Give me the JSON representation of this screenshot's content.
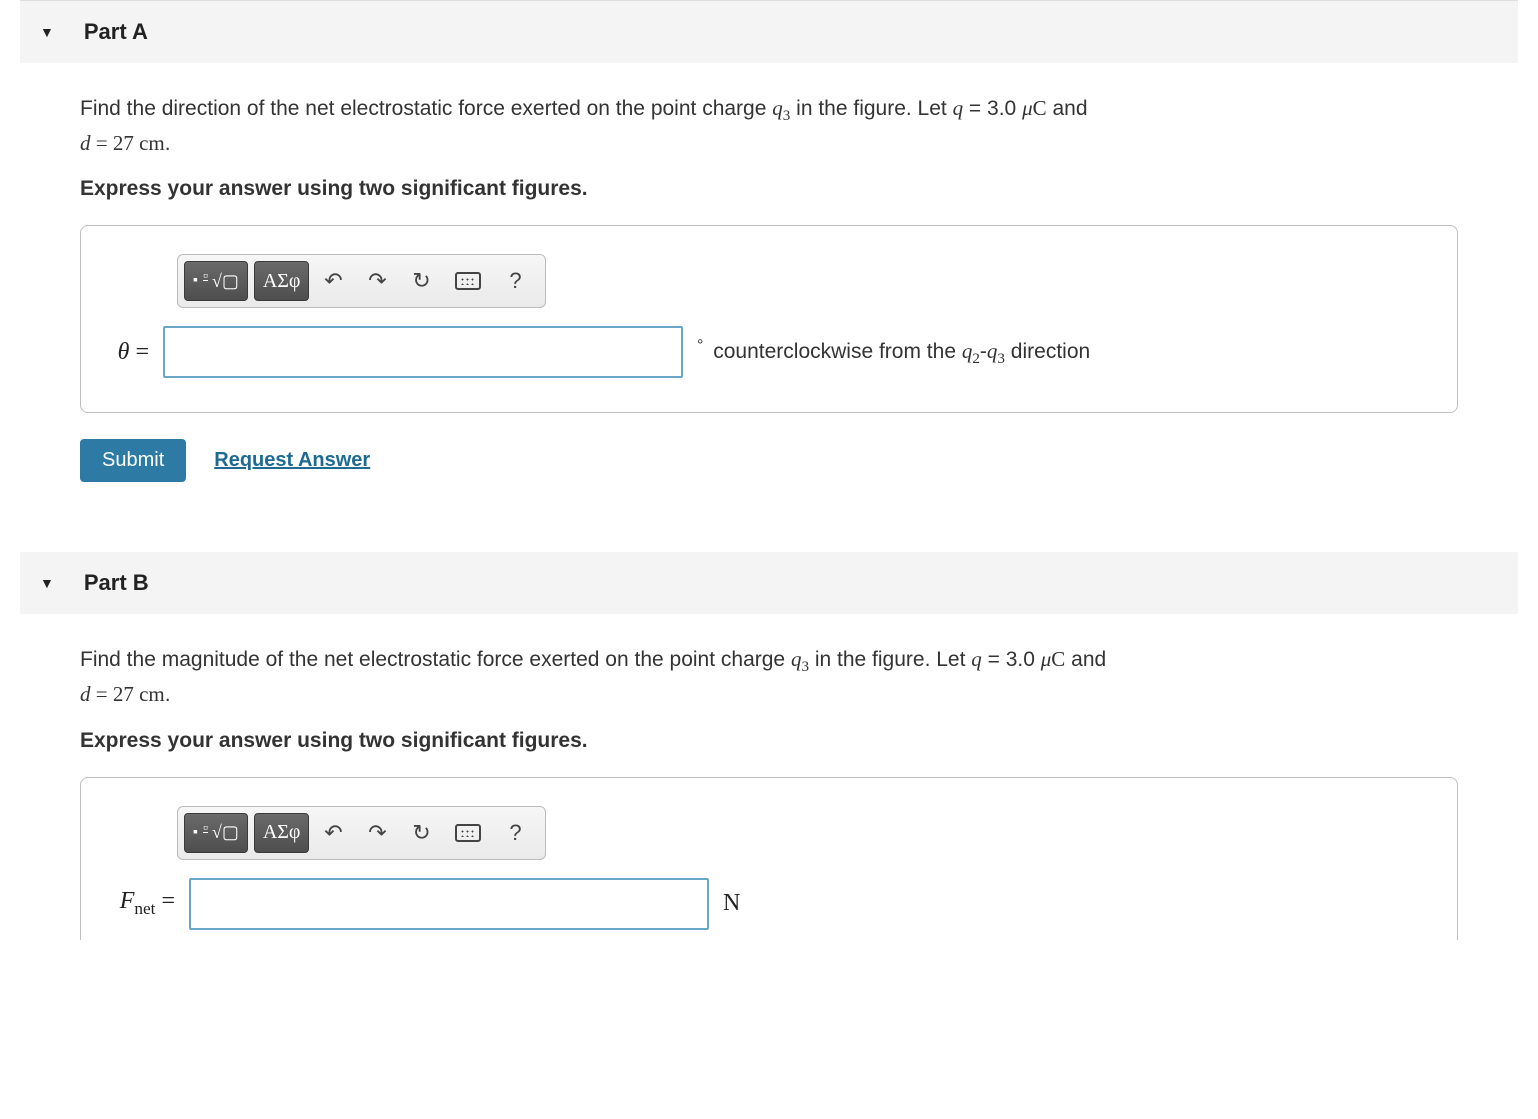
{
  "parts": [
    {
      "label": "Part A",
      "prompt_pre": "Find the direction of the net electrostatic force exerted on the point charge ",
      "q_var": "q",
      "q_sub": "3",
      "prompt_mid": " in the figure. Let ",
      "let_q_var": "q",
      "let_q_eq": " = 3.0 ",
      "let_q_unit_mu": "μ",
      "let_q_unit_c": "C",
      "and": " and ",
      "d_var": "d",
      "d_eq": " = 27 ",
      "d_unit": "cm",
      "period": ".",
      "instruction": "Express your answer using two significant figures.",
      "lhs_var": "θ",
      "lhs_eq": " =",
      "unit_pre_degree": "°",
      "unit_text_pre": " counterclockwise from the ",
      "unit_q2": "q",
      "unit_q2_sub": "2",
      "dash": "-",
      "unit_q3": "q",
      "unit_q3_sub": "3",
      "unit_text_post": " direction"
    },
    {
      "label": "Part B",
      "prompt_pre": "Find the magnitude of the net electrostatic force exerted on the point charge ",
      "q_var": "q",
      "q_sub": "3",
      "prompt_mid": " in the figure. Let ",
      "let_q_var": "q",
      "let_q_eq": " = 3.0 ",
      "let_q_unit_mu": "μ",
      "let_q_unit_c": "C",
      "and": " and ",
      "d_var": "d",
      "d_eq": " = 27 ",
      "d_unit": "cm",
      "period": ".",
      "instruction": "Express your answer using two significant figures.",
      "lhs_F": "F",
      "lhs_sub": "net",
      "lhs_eq": " =",
      "unit_b": "N"
    }
  ],
  "toolbar": {
    "templates_label": "▢",
    "sqrt_label": "√▢",
    "greek_label": "ΑΣφ",
    "undo_glyph": "↶",
    "redo_glyph": "↷",
    "reset_glyph": "↻",
    "help_glyph": "?"
  },
  "actions": {
    "submit": "Submit",
    "request": "Request Answer"
  }
}
